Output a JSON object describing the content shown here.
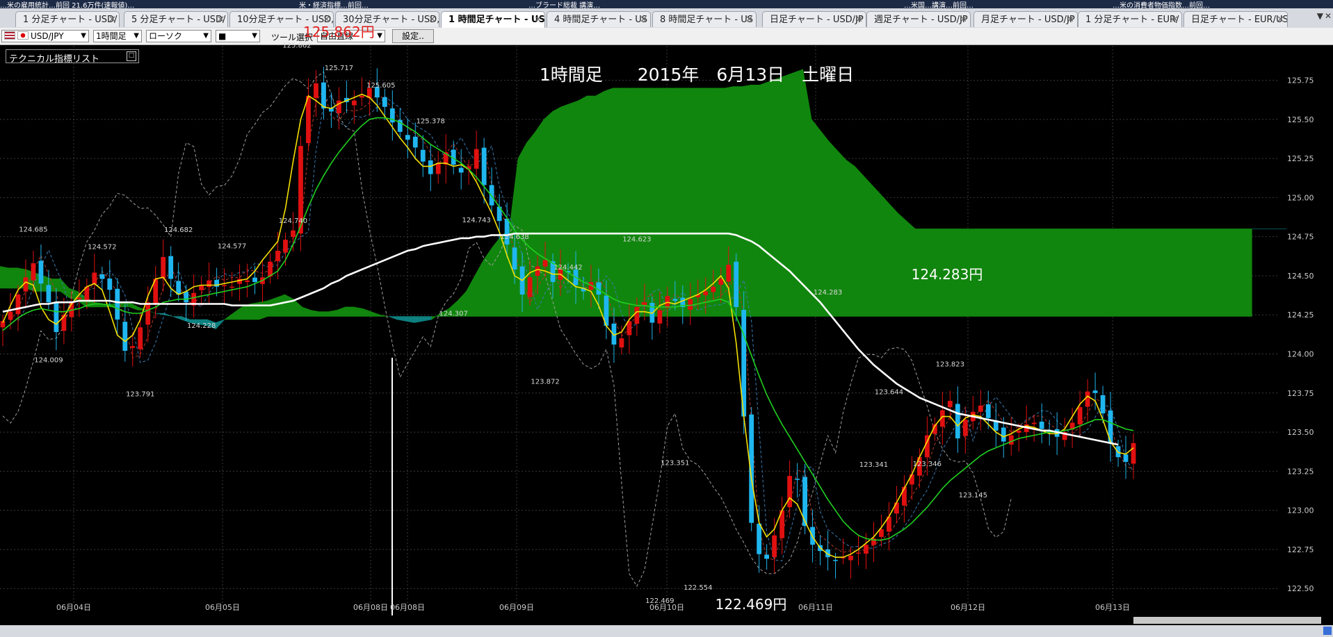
{
  "news_bar": [
    {
      "text": "…米の雇用統計…前回 21.6万件(速報値)…"
    },
    {
      "text": "米・経済指標…前回…"
    },
    {
      "text": "…ブラード総裁 講演…"
    },
    {
      "text": "…米国…講演…前回…"
    },
    {
      "text": "…米の消費者物価指数…前回…"
    }
  ],
  "tabs": [
    {
      "label": "1 分足チャート - USD/",
      "active": false
    },
    {
      "label": "5 分足チャート - USD/",
      "active": false
    },
    {
      "label": "10分足チャート - USD,",
      "active": false
    },
    {
      "label": "30分足チャート - USD,",
      "active": false
    },
    {
      "label": "1 時間足チャート - US",
      "active": true
    },
    {
      "label": "4 時間足チャート - US",
      "active": false
    },
    {
      "label": "8 時間足チャート - US",
      "active": false
    },
    {
      "label": "日足チャート - USD/JP",
      "active": false
    },
    {
      "label": "週足チャート - USD/JP",
      "active": false
    },
    {
      "label": "月足チャート - USD/JP",
      "active": false
    },
    {
      "label": "1 分足チャート - EUR/",
      "active": false
    },
    {
      "label": "日足チャート - EUR/US",
      "active": false
    }
  ],
  "toolbar": {
    "symbol": "USD/JPY",
    "timeframe": "1時間足",
    "chart_style": "ローソク",
    "color_select": "■",
    "tool_label": "ツール選択",
    "draw_select": "自由直線",
    "settings_label": "設定.."
  },
  "indicator_list_label": "テクニカル指標リスト",
  "colors": {
    "up_candle": "#e01010",
    "down_candle": "#1fb6f0",
    "cloud_bull": "#11860e",
    "cloud_bear": "#0e8080",
    "sma_fast": "#f5e000",
    "sma_mid": "#20d020",
    "sma_long": "#ffffff",
    "ichimoku_dashed": "#a0a0a0"
  },
  "chart_data": {
    "type": "candlestick",
    "title": "1時間足　　2015年　6月13日　土曜日",
    "annotations": [
      "125.862円",
      "124.283円",
      "122.469円"
    ],
    "price_labels": [
      {
        "value": 125.862,
        "label": "125.862"
      },
      {
        "value": 125.717,
        "label": "125.717"
      },
      {
        "value": 125.605,
        "label": "125.605"
      },
      {
        "value": 125.378,
        "label": "125.378"
      },
      {
        "value": 124.685,
        "label": "124.685"
      },
      {
        "value": 124.682,
        "label": "124.682"
      },
      {
        "value": 124.572,
        "label": "124.572"
      },
      {
        "value": 124.577,
        "label": "124.577"
      },
      {
        "value": 124.74,
        "label": "124.740"
      },
      {
        "value": 124.743,
        "label": "124.743"
      },
      {
        "value": 124.638,
        "label": "124.638"
      },
      {
        "value": 124.623,
        "label": "124.623"
      },
      {
        "value": 124.442,
        "label": "124.442"
      },
      {
        "value": 124.307,
        "label": "124.307"
      },
      {
        "value": 124.228,
        "label": "124.228"
      },
      {
        "value": 124.009,
        "label": "124.009"
      },
      {
        "value": 123.791,
        "label": "123.791"
      },
      {
        "value": 123.872,
        "label": "123.872"
      },
      {
        "value": 124.283,
        "label": "124.283"
      },
      {
        "value": 123.823,
        "label": "123.823"
      },
      {
        "value": 123.644,
        "label": "123.644"
      },
      {
        "value": 123.341,
        "label": "123.341"
      },
      {
        "value": 123.346,
        "label": "123.346"
      },
      {
        "value": 123.351,
        "label": "123.351"
      },
      {
        "value": 123.145,
        "label": "123.145"
      },
      {
        "value": 122.554,
        "label": "122.554"
      },
      {
        "value": 122.469,
        "label": "122.469"
      }
    ],
    "ylim": [
      122.39,
      125.97
    ],
    "y_ticks": [
      "125.75",
      "125.50",
      "125.25",
      "125.00",
      "124.75",
      "124.50",
      "124.25",
      "124.00",
      "123.75",
      "123.50",
      "123.25",
      "123.00",
      "122.75",
      "122.50"
    ],
    "x_ticks": [
      "06月04日",
      "06月05日",
      "06月08日",
      "06月08日",
      "06月09日",
      "06月10日",
      "06月11日",
      "06月12日",
      "06月13日"
    ],
    "grid": true,
    "series": [
      {
        "kind": "price",
        "values": [
          124.21,
          124.27,
          124.38,
          124.49,
          124.58,
          124.45,
          124.33,
          124.14,
          124.25,
          124.33,
          124.36,
          124.43,
          124.52,
          124.48,
          124.41,
          124.22,
          124.02,
          124.05,
          124.17,
          124.33,
          124.48,
          124.62,
          124.48,
          124.38,
          124.33,
          124.39,
          124.44,
          124.47,
          124.43,
          124.44,
          124.43,
          124.48,
          124.47,
          124.46,
          124.49,
          124.59,
          124.66,
          124.73,
          124.79,
          125.33,
          125.65,
          125.73,
          125.57,
          125.55,
          125.62,
          125.61,
          125.62,
          125.65,
          125.7,
          125.64,
          125.58,
          125.48,
          125.42,
          125.37,
          125.32,
          125.23,
          125.15,
          125.22,
          125.29,
          125.21,
          125.16,
          125.2,
          125.31,
          125.08,
          124.95,
          124.85,
          124.7,
          124.54,
          124.38,
          124.49,
          124.56,
          124.6,
          124.46,
          124.55,
          124.52,
          124.44,
          124.4,
          124.46,
          124.38,
          124.18,
          124.06,
          124.1,
          124.21,
          124.3,
          124.33,
          124.2,
          124.28,
          124.37,
          124.34,
          124.3,
          124.35,
          124.38,
          124.4,
          124.43,
          124.48,
          124.57,
          124.3,
          123.6,
          122.92,
          122.72,
          122.69,
          122.84,
          123.0,
          123.22,
          123.2,
          122.9,
          122.78,
          122.74,
          122.7,
          122.68,
          122.7,
          122.71,
          122.73,
          122.78,
          122.82,
          122.88,
          122.96,
          123.05,
          123.15,
          123.23,
          123.34,
          123.48,
          123.55,
          123.64,
          123.7,
          123.46,
          123.58,
          123.63,
          123.67,
          123.59,
          123.51,
          123.44,
          123.48,
          123.51,
          123.55,
          123.56,
          123.52,
          123.5,
          123.47,
          123.5,
          123.56,
          123.66,
          123.76,
          123.75,
          123.62,
          123.43,
          123.34,
          123.31,
          123.43
        ]
      },
      {
        "kind": "sma_fast",
        "values": [
          124.2,
          124.31,
          124.41,
          124.46,
          124.44,
          124.3,
          124.22,
          124.19,
          124.24,
          124.32,
          124.38,
          124.43,
          124.45,
          124.41,
          124.27,
          124.12,
          124.08,
          124.12,
          124.22,
          124.37,
          124.48,
          124.49,
          124.42,
          124.38,
          124.4,
          124.43,
          124.44,
          124.44,
          124.44,
          124.45,
          124.46,
          124.47,
          124.48,
          124.53,
          124.6,
          124.66,
          124.72,
          124.93,
          125.23,
          125.5,
          125.65,
          125.62,
          125.58,
          125.57,
          125.6,
          125.62,
          125.64,
          125.66,
          125.64,
          125.59,
          125.52,
          125.45,
          125.38,
          125.32,
          125.25,
          125.2,
          125.2,
          125.22,
          125.22,
          125.2,
          125.21,
          125.18,
          125.1,
          125.0,
          124.9,
          124.78,
          124.63,
          124.5,
          124.47,
          124.52,
          124.54,
          124.53,
          124.51,
          124.51,
          124.47,
          124.43,
          124.42,
          124.4,
          124.31,
          124.18,
          124.12,
          124.14,
          124.22,
          124.27,
          124.27,
          124.26,
          124.31,
          124.33,
          124.32,
          124.34,
          124.36,
          124.38,
          124.41,
          124.45,
          124.5,
          124.42,
          124.07,
          123.6,
          123.2,
          122.92,
          122.83,
          122.88,
          123.0,
          123.08,
          123.04,
          122.93,
          122.83,
          122.76,
          122.72,
          122.7,
          122.7,
          122.72,
          122.75,
          122.79,
          122.83,
          122.89,
          122.96,
          123.05,
          123.14,
          123.23,
          123.34,
          123.44,
          123.54,
          123.6,
          123.6,
          123.54,
          123.59,
          123.61,
          123.6,
          123.55,
          123.5,
          123.47,
          123.49,
          123.52,
          123.54,
          123.53,
          123.51,
          123.49,
          123.49,
          123.52,
          123.6,
          123.68,
          123.73,
          123.7,
          123.58,
          123.44,
          123.37,
          123.36,
          123.4
        ]
      },
      {
        "kind": "sma_mid",
        "values": [
          124.15,
          124.19,
          124.23,
          124.26,
          124.28,
          124.29,
          124.28,
          124.27,
          124.27,
          124.28,
          124.29,
          124.31,
          124.32,
          124.32,
          124.31,
          124.29,
          124.27,
          124.26,
          124.26,
          124.28,
          124.3,
          124.33,
          124.34,
          124.35,
          124.35,
          124.36,
          124.37,
          124.38,
          124.39,
          124.4,
          124.41,
          124.42,
          124.43,
          124.45,
          124.47,
          124.5,
          124.53,
          124.6,
          124.7,
          124.82,
          124.94,
          125.05,
          125.14,
          125.22,
          125.29,
          125.35,
          125.41,
          125.46,
          125.5,
          125.51,
          125.51,
          125.5,
          125.48,
          125.45,
          125.42,
          125.38,
          125.34,
          125.31,
          125.28,
          125.25,
          125.22,
          125.18,
          125.13,
          125.07,
          125.01,
          124.94,
          124.87,
          124.79,
          124.73,
          124.68,
          124.64,
          124.61,
          124.58,
          124.55,
          124.52,
          124.49,
          124.46,
          124.44,
          124.41,
          124.38,
          124.35,
          124.33,
          124.32,
          124.31,
          124.31,
          124.3,
          124.3,
          124.3,
          124.3,
          124.31,
          124.31,
          124.32,
          124.33,
          124.34,
          124.35,
          124.33,
          124.24,
          124.12,
          123.99,
          123.86,
          123.74,
          123.64,
          123.55,
          123.47,
          123.39,
          123.31,
          123.23,
          123.15,
          123.07,
          123.0,
          122.93,
          122.88,
          122.84,
          122.82,
          122.81,
          122.81,
          122.82,
          122.85,
          122.88,
          122.92,
          122.97,
          123.02,
          123.08,
          123.14,
          123.19,
          123.23,
          123.27,
          123.31,
          123.35,
          123.38,
          123.4,
          123.42,
          123.44,
          123.46,
          123.47,
          123.48,
          123.49,
          123.5,
          123.5,
          123.51,
          123.52,
          123.54,
          123.56,
          123.58,
          123.58,
          123.56,
          123.54,
          123.52,
          123.51
        ]
      },
      {
        "kind": "sma_long",
        "values": [
          124.27,
          124.28,
          124.29,
          124.3,
          124.31,
          124.32,
          124.32,
          124.33,
          124.33,
          124.33,
          124.34,
          124.34,
          124.34,
          124.34,
          124.34,
          124.33,
          124.33,
          124.33,
          124.32,
          124.32,
          124.32,
          124.32,
          124.32,
          124.32,
          124.32,
          124.32,
          124.32,
          124.32,
          124.32,
          124.32,
          124.31,
          124.31,
          124.31,
          124.31,
          124.31,
          124.31,
          124.32,
          124.33,
          124.34,
          124.36,
          124.38,
          124.4,
          124.42,
          124.45,
          124.47,
          124.5,
          124.52,
          124.54,
          124.56,
          124.58,
          124.6,
          124.62,
          124.64,
          124.66,
          124.67,
          124.69,
          124.7,
          124.71,
          124.72,
          124.73,
          124.74,
          124.74,
          124.75,
          124.75,
          124.76,
          124.76,
          124.76,
          124.77,
          124.77,
          124.77,
          124.77,
          124.77,
          124.77,
          124.77,
          124.77,
          124.77,
          124.77,
          124.77,
          124.77,
          124.77,
          124.77,
          124.77,
          124.77,
          124.77,
          124.77,
          124.77,
          124.77,
          124.77,
          124.77,
          124.77,
          124.77,
          124.77,
          124.77,
          124.77,
          124.77,
          124.77,
          124.76,
          124.74,
          124.72,
          124.69,
          124.65,
          124.61,
          124.57,
          124.53,
          124.48,
          124.43,
          124.38,
          124.33,
          124.27,
          124.21,
          124.15,
          124.09,
          124.03,
          123.98,
          123.93,
          123.89,
          123.85,
          123.81,
          123.78,
          123.75,
          123.72,
          123.7,
          123.68,
          123.66,
          123.64,
          123.62,
          123.61,
          123.6,
          123.59,
          123.58,
          123.57,
          123.56,
          123.55,
          123.54,
          123.53,
          123.52,
          123.51,
          123.51,
          123.5,
          123.49,
          123.48,
          123.47,
          123.46,
          123.45,
          123.44,
          123.43,
          123.42
        ]
      }
    ],
    "ichimoku_cloud": {
      "span_a": [
        124.56,
        124.55,
        124.55,
        124.54,
        124.52,
        124.5,
        124.48,
        124.48,
        124.42,
        124.4,
        124.36,
        124.33,
        124.32,
        124.32,
        124.33,
        124.33,
        124.3,
        124.28,
        124.26,
        124.25,
        124.24,
        124.22,
        124.2,
        124.19,
        124.18,
        124.16,
        124.22,
        124.26,
        124.3,
        124.32,
        124.33,
        124.34,
        124.36,
        124.38,
        124.35,
        124.3,
        124.28,
        124.27,
        124.27,
        124.28,
        124.3,
        124.3,
        124.29,
        124.27,
        124.25,
        124.24,
        124.22,
        124.21,
        124.2,
        124.21,
        124.22,
        124.26,
        124.29,
        124.34,
        124.4,
        124.5,
        124.6,
        124.68,
        124.75,
        124.8,
        125.25,
        125.35,
        125.42,
        125.5,
        125.55,
        125.58,
        125.6,
        125.62,
        125.65,
        125.65,
        125.68,
        125.7,
        125.7,
        125.7,
        125.7,
        125.7,
        125.7,
        125.7,
        125.7,
        125.7,
        125.7,
        125.7,
        125.7,
        125.7,
        125.7,
        125.71,
        125.71,
        125.72,
        125.72,
        125.74,
        125.76,
        125.78,
        125.8,
        125.82,
        125.5,
        125.43,
        125.36,
        125.3,
        125.24,
        125.2,
        125.14,
        125.08,
        125.02,
        124.96,
        124.9,
        124.85,
        124.8,
        124.8,
        124.8,
        124.8,
        124.8,
        124.8,
        124.8,
        124.8,
        124.8,
        124.8,
        124.8,
        124.8,
        124.8,
        124.8,
        124.8,
        124.8,
        124.8,
        124.8,
        124.8,
        124.8,
        124.8,
        124.8,
        124.8,
        124.8,
        124.8,
        124.8,
        124.8,
        124.8,
        124.8,
        124.8,
        124.8,
        124.8,
        124.8,
        124.8,
        124.8,
        124.8,
        124.8,
        124.8,
        124.8,
        124.8,
        124.8,
        124.8,
        124.8,
        124.8
      ],
      "span_b": [
        124.42,
        124.42,
        124.42,
        124.42,
        124.4,
        124.4,
        124.4,
        124.4,
        124.36,
        124.34,
        124.3,
        124.3,
        124.3,
        124.3,
        124.3,
        124.3,
        124.28,
        124.28,
        124.26,
        124.26,
        124.24,
        124.24,
        124.22,
        124.22,
        124.22,
        124.2,
        124.22,
        124.22,
        124.22,
        124.22,
        124.22,
        124.24,
        124.24,
        124.24,
        124.24,
        124.24,
        124.24,
        124.24,
        124.24,
        124.24,
        124.24,
        124.24,
        124.24,
        124.24,
        124.24,
        124.24,
        124.24,
        124.24,
        124.24,
        124.24,
        124.24,
        124.24,
        124.24,
        124.24,
        124.24,
        124.24,
        124.24,
        124.24,
        124.24,
        124.24,
        124.24,
        124.24,
        124.24,
        124.24,
        124.24,
        124.24,
        124.24,
        124.24,
        124.24,
        124.24,
        124.24,
        124.24,
        124.24,
        124.24,
        124.24,
        124.24,
        124.24,
        124.24,
        124.24,
        124.24,
        124.24,
        124.24,
        124.24,
        124.24,
        124.24,
        124.24,
        124.24,
        124.24,
        124.24,
        124.24,
        124.24,
        124.24,
        124.24,
        124.24,
        124.24,
        124.24,
        124.24,
        124.24,
        124.24,
        124.24,
        124.24,
        124.24,
        124.24,
        124.24,
        124.24,
        124.24,
        124.24,
        124.24,
        124.24,
        124.24,
        124.24,
        124.24,
        124.24,
        124.24,
        124.24,
        124.24,
        124.24,
        124.24,
        124.24,
        124.24,
        124.24,
        124.24,
        124.24,
        124.24,
        124.24,
        124.24,
        124.24,
        124.24,
        124.24,
        124.24,
        124.24,
        124.24,
        124.24,
        124.24,
        124.24,
        124.24,
        124.24,
        124.24,
        124.24,
        124.24,
        124.24,
        124.24,
        124.24,
        124.24,
        124.24,
        124.24
      ]
    }
  }
}
